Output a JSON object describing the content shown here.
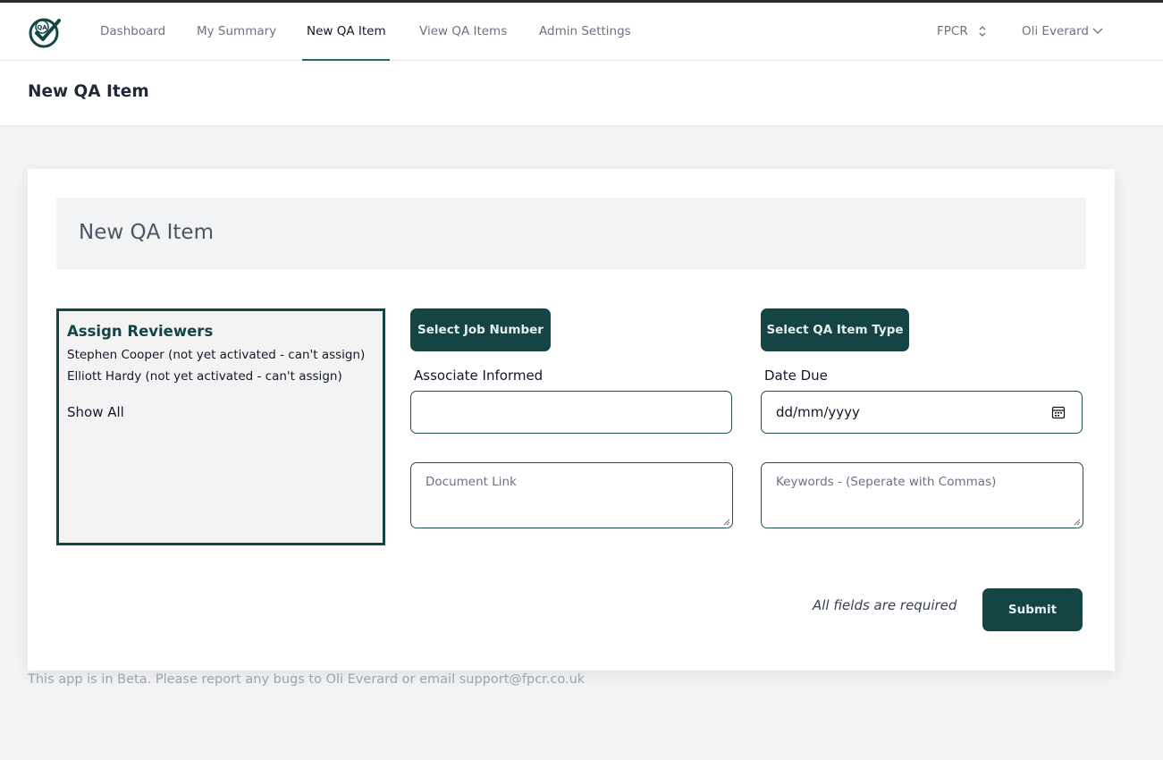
{
  "nav": {
    "logo_text": "QA",
    "items": [
      {
        "label": "Dashboard"
      },
      {
        "label": "My Summary"
      },
      {
        "label": "New QA Item"
      },
      {
        "label": "View QA Items"
      },
      {
        "label": "Admin Settings"
      }
    ],
    "active_index": 2,
    "org": "FPCR",
    "user": "Oli Everard"
  },
  "page": {
    "title": "New QA Item"
  },
  "card": {
    "title": "New QA Item",
    "reviewers": {
      "heading": "Assign Reviewers",
      "items": [
        "Stephen Cooper (not yet activated - can't assign)",
        "Elliott Hardy (not yet activated - can't assign)"
      ],
      "show_all": "Show All"
    },
    "buttons": {
      "select_job": "Select Job Number",
      "select_type": "Select QA Item Type",
      "submit": "Submit"
    },
    "fields": {
      "associate_label": "Associate Informed",
      "associate_value": "",
      "date_label": "Date Due",
      "date_value": "dd/mm/yyyy",
      "document_placeholder": "Document Link",
      "keywords_placeholder": "Keywords - (Seperate with Commas)"
    },
    "required_note": "All fields are required"
  },
  "footer": "This app is in Beta. Please report any bugs to Oli Everard or email support@fpcr.co.uk",
  "colors": {
    "brand": "#144444",
    "accent": "#1f6b5c",
    "background": "#f2f3f5"
  }
}
